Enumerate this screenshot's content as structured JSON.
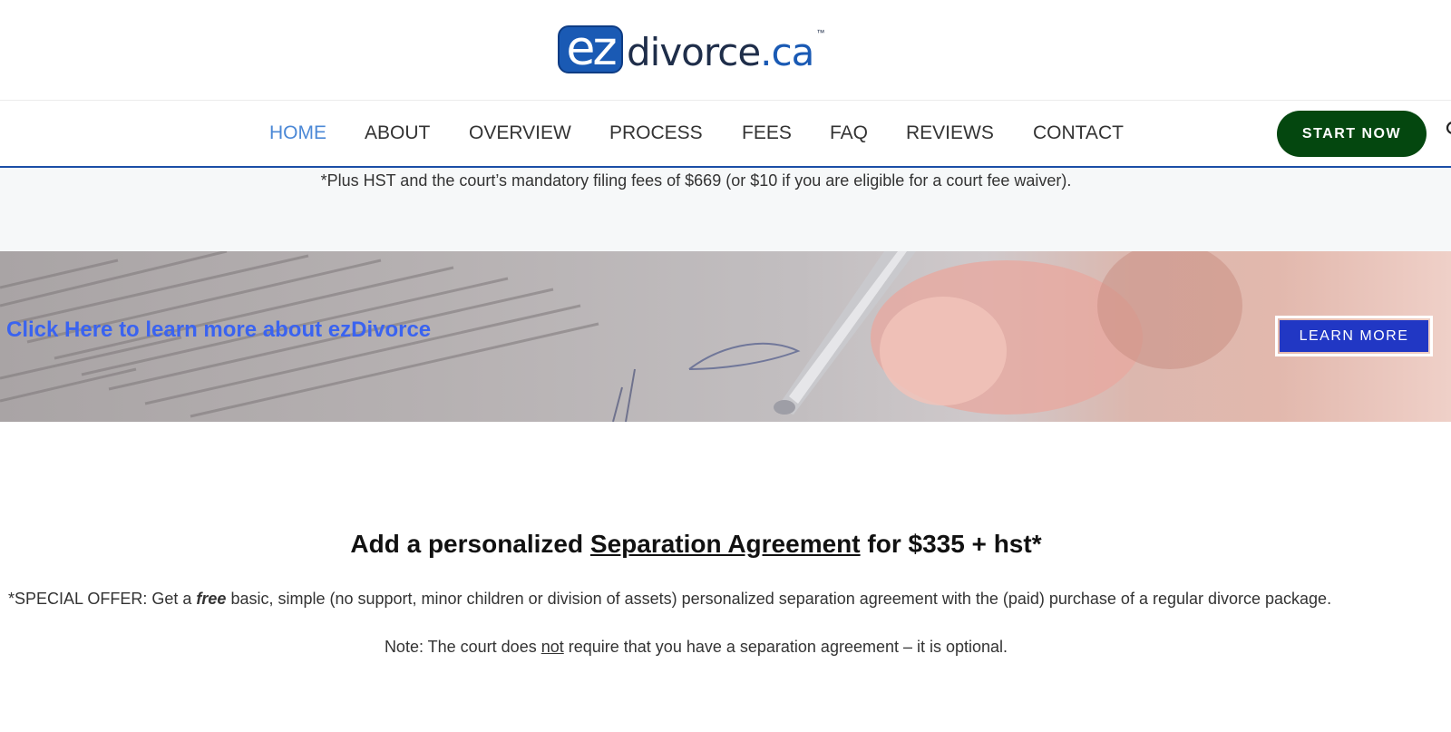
{
  "header": {
    "logo": {
      "ez": "ez",
      "divorce": "divorce",
      "ca": ".ca",
      "tm": "™"
    }
  },
  "nav": {
    "items": [
      {
        "label": "HOME",
        "active": true
      },
      {
        "label": "ABOUT",
        "active": false
      },
      {
        "label": "OVERVIEW",
        "active": false
      },
      {
        "label": "PROCESS",
        "active": false
      },
      {
        "label": "FEES",
        "active": false
      },
      {
        "label": "FAQ",
        "active": false
      },
      {
        "label": "REVIEWS",
        "active": false
      },
      {
        "label": "CONTACT",
        "active": false
      }
    ],
    "start_label": "START NOW",
    "search_icon": "search-icon"
  },
  "fees": {
    "note": "*Plus HST and the court’s mandatory filing fees of $669 (or $10 if you are eligible for a court fee waiver)."
  },
  "banner": {
    "link_text": "Click Here to learn more about ezDivorce",
    "button_label": "LEARN MORE"
  },
  "offer": {
    "title_pre": "Add a personalized ",
    "title_link": "Separation Agreement",
    "title_post": " for $335 + hst*",
    "text_pre": "*SPECIAL OFFER: Get a ",
    "text_em": "free",
    "text_post": " basic, simple (no support, minor children or division of assets) personalized separation agreement with the (paid) purchase of a regular divorce package.",
    "note_pre": "Note: The court does ",
    "note_u": "not",
    "note_post": " require that you have a separation agreement – it is optional."
  },
  "colors": {
    "nav_active": "#4b88d6",
    "start_button": "#04470f",
    "learn_button": "#2137c4",
    "banner_link": "#3a63f0",
    "brand_blue": "#1a5ab4"
  }
}
